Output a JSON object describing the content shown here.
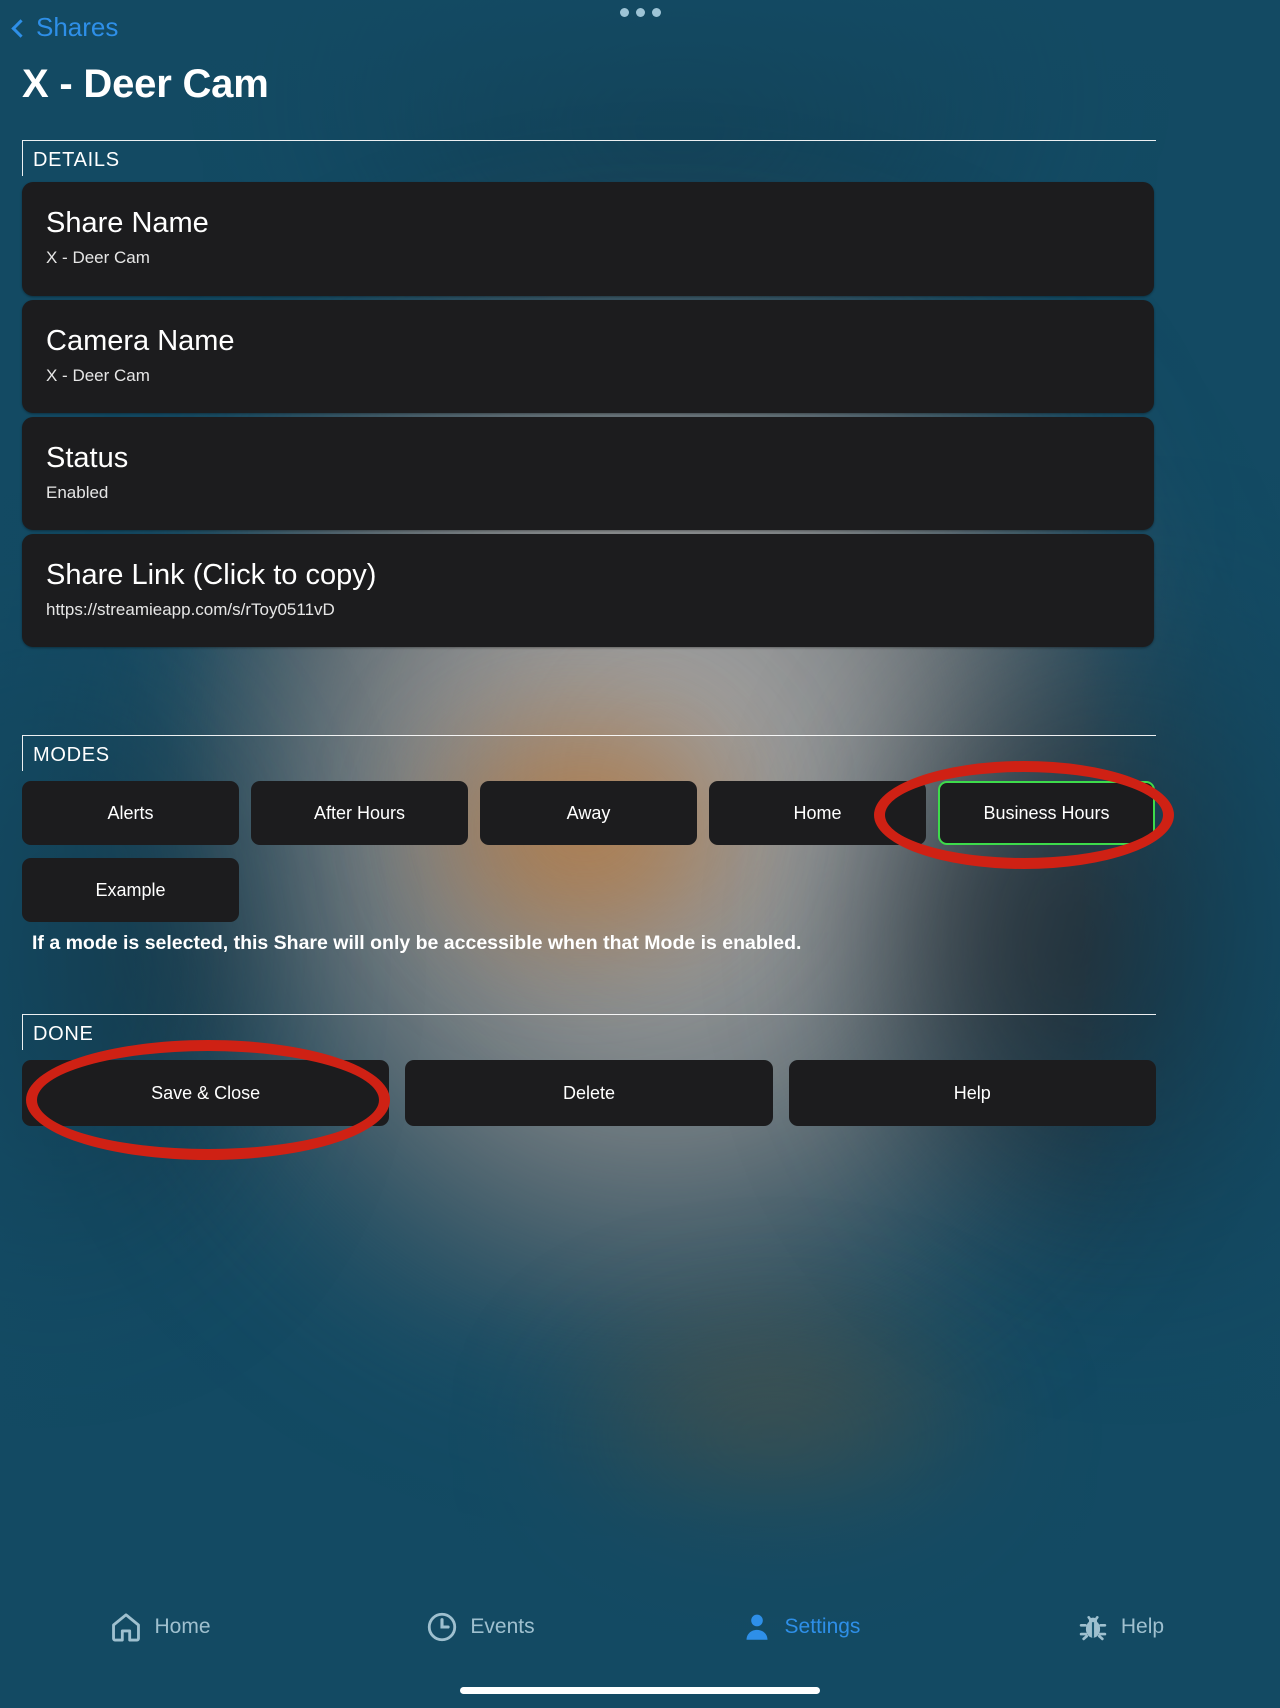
{
  "nav": {
    "back_label": "Shares",
    "drag_handle_icon": "drag-handle-dots-icon"
  },
  "page_title": "X - Deer Cam",
  "sections": {
    "details_legend": "DETAILS",
    "modes_legend": "MODES",
    "done_legend": "DONE"
  },
  "details": [
    {
      "title": "Share Name",
      "value": "X - Deer Cam"
    },
    {
      "title": "Camera Name",
      "value": "X - Deer Cam"
    },
    {
      "title": "Status",
      "value": "Enabled"
    },
    {
      "title": "Share Link (Click to copy)",
      "value": "https://streamieapp.com/s/rToy0511vD"
    }
  ],
  "modes": {
    "buttons": [
      {
        "label": "Alerts",
        "selected": false
      },
      {
        "label": "After Hours",
        "selected": false
      },
      {
        "label": "Away",
        "selected": false
      },
      {
        "label": "Home",
        "selected": false
      },
      {
        "label": "Business Hours",
        "selected": true
      },
      {
        "label": "Example",
        "selected": false
      }
    ],
    "help_text": "If a mode is selected, this Share will only be accessible when that Mode is enabled.",
    "selected_border_color": "#3ddb4b"
  },
  "done": {
    "buttons": [
      {
        "label": "Save & Close"
      },
      {
        "label": "Delete"
      },
      {
        "label": "Help"
      }
    ]
  },
  "annotations": {
    "color": "#cf2114",
    "shapes": [
      {
        "name": "business-hours-highlight",
        "target": "Business Hours"
      },
      {
        "name": "save-close-highlight",
        "target": "Save & Close"
      }
    ]
  },
  "tabbar": {
    "items": [
      {
        "label": "Home",
        "icon": "house-icon",
        "active": false
      },
      {
        "label": "Events",
        "icon": "clock-icon",
        "active": false
      },
      {
        "label": "Settings",
        "icon": "person-icon",
        "active": true
      },
      {
        "label": "Help",
        "icon": "bug-icon",
        "active": false
      }
    ],
    "active_color": "#2e8fe8",
    "inactive_color": "#9fc0cf"
  },
  "theme": {
    "background": "#134a63",
    "card_background": "#1c1c1e",
    "accent_blue": "#2e8fe8"
  }
}
